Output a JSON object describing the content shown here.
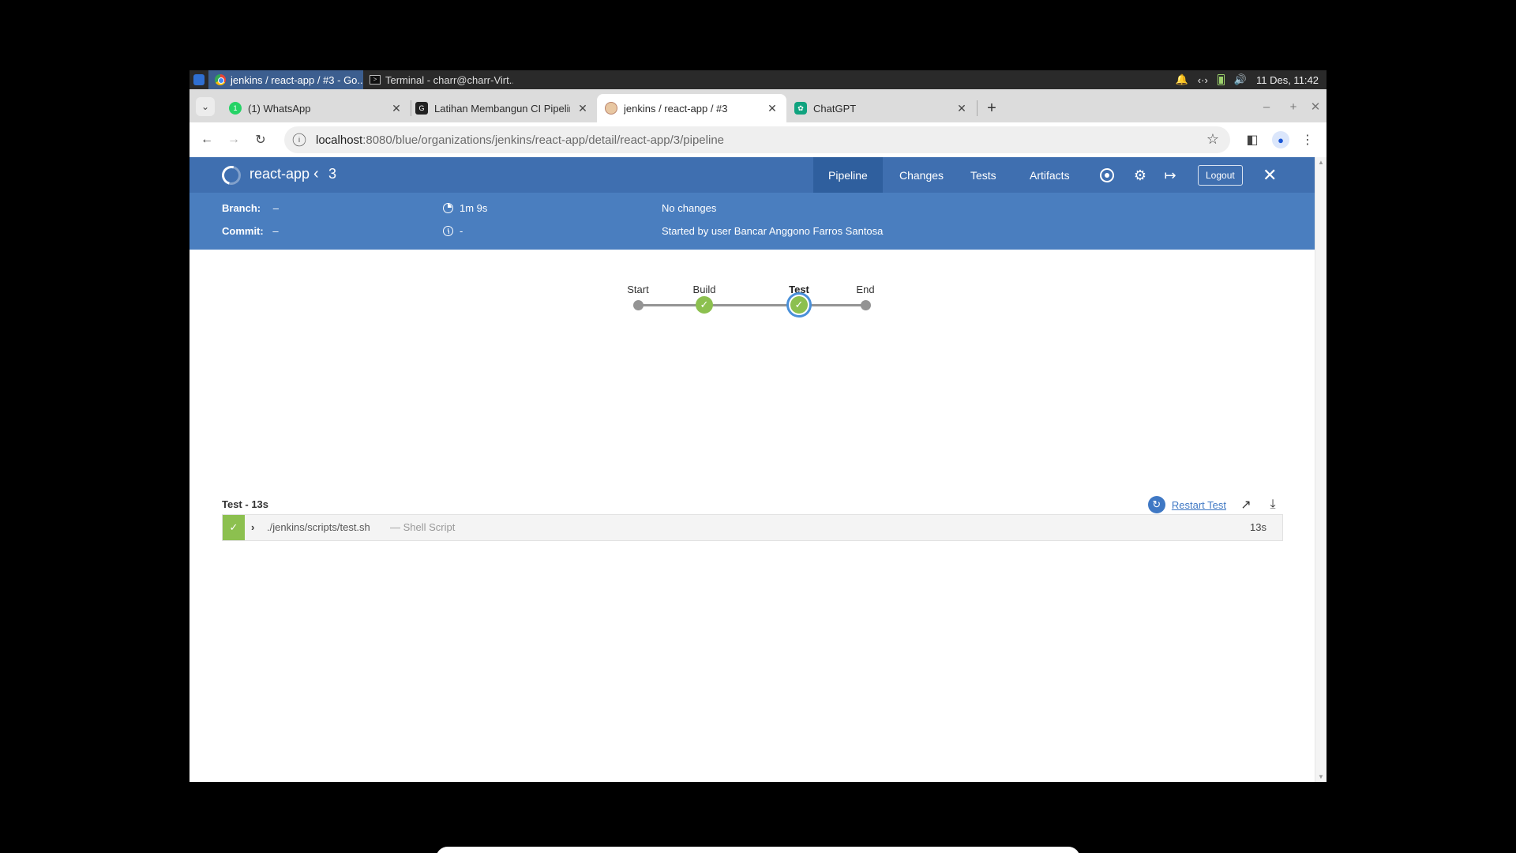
{
  "os": {
    "tasks": [
      {
        "label": "jenkins / react-app / #3 - Go...",
        "active": true
      },
      {
        "label": "Terminal - charr@charr-Virt...",
        "active": false
      }
    ],
    "clock": "11 Des, 11:42"
  },
  "browser": {
    "tabs": [
      {
        "title": "(1) WhatsApp",
        "favicon": "whatsapp-icon",
        "active": false
      },
      {
        "title": "Latihan Membangun CI Pipeline",
        "favicon": "github-icon",
        "active": false
      },
      {
        "title": "jenkins / react-app / #3",
        "favicon": "jenkins-icon",
        "active": true
      },
      {
        "title": "ChatGPT",
        "favicon": "chatgpt-icon",
        "active": false
      }
    ],
    "url": {
      "host": "localhost",
      "path": ":8080/blue/organizations/jenkins/react-app/detail/react-app/3/pipeline"
    }
  },
  "jenkins": {
    "header": {
      "pipeline": "react-app",
      "run_number": "3",
      "nav": [
        "Pipeline",
        "Changes",
        "Tests",
        "Artifacts"
      ],
      "active_nav": "Pipeline",
      "logout_label": "Logout"
    },
    "run_info": {
      "branch_label": "Branch:",
      "branch_value": "–",
      "commit_label": "Commit:",
      "commit_value": "–",
      "duration": "1m 9s",
      "time_ago": "-",
      "changes": "No changes",
      "cause": "Started by user Bancar Anggono Farros Santosa"
    },
    "graph": {
      "stages": [
        {
          "name": "Start",
          "status": "start"
        },
        {
          "name": "Build",
          "status": "success"
        },
        {
          "name": "Test",
          "status": "success",
          "selected": true
        },
        {
          "name": "End",
          "status": "end"
        }
      ]
    },
    "step_panel": {
      "title": "Test - 13s",
      "restart_label": "Restart Test",
      "steps": [
        {
          "name": "./jenkins/scripts/test.sh",
          "type": "— Shell Script",
          "duration": "13s",
          "status": "success"
        }
      ]
    }
  },
  "colors": {
    "header_bg": "#3f6fb0",
    "info_bg": "#4a7ebf",
    "success": "#8cc04f",
    "link": "#3f78c4"
  }
}
